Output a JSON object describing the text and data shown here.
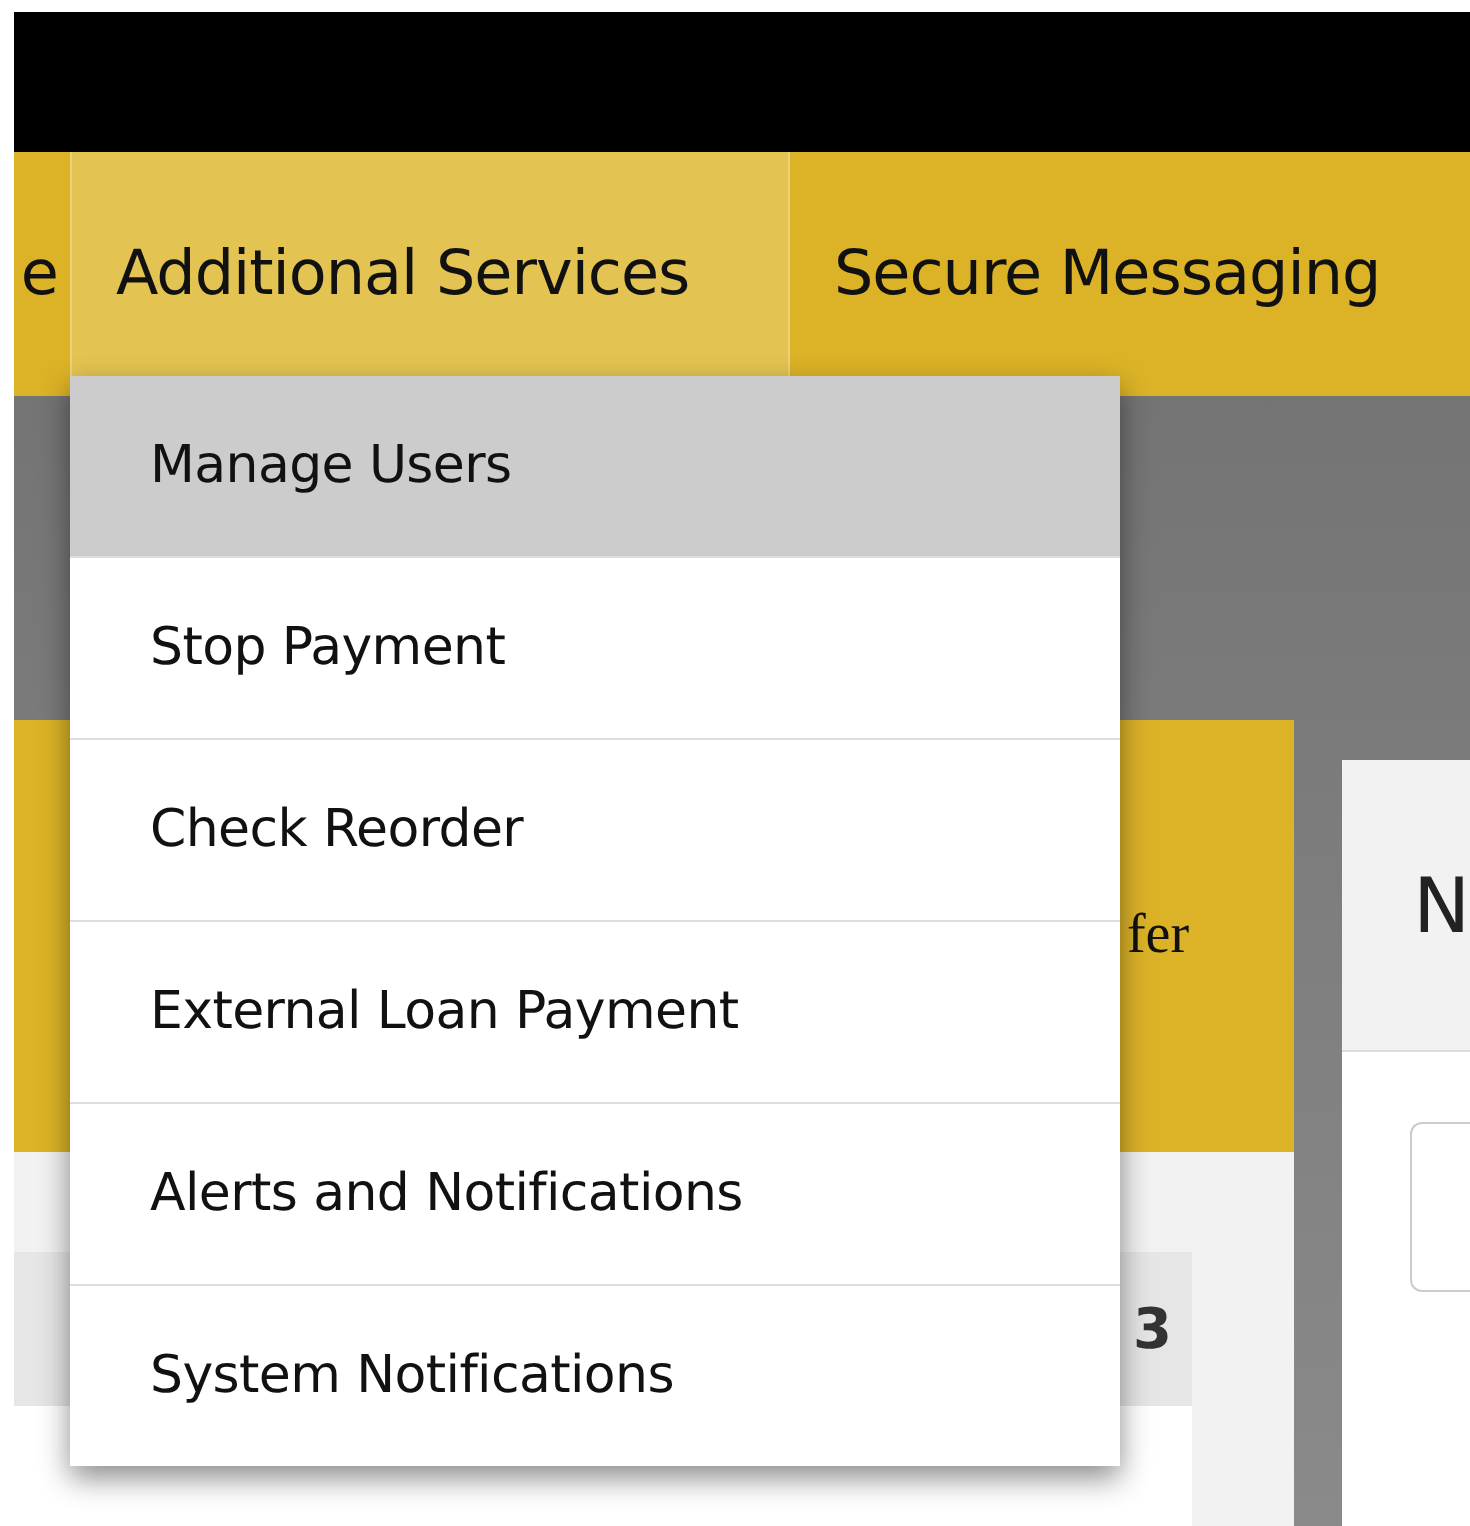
{
  "nav": {
    "items": [
      {
        "label": "e",
        "selected": false
      },
      {
        "label": "Additional Services",
        "selected": true
      },
      {
        "label": "Secure Messaging",
        "selected": false
      }
    ]
  },
  "dropdown": {
    "items": [
      {
        "label": "Manage Users",
        "selected": true
      },
      {
        "label": "Stop Payment",
        "selected": false
      },
      {
        "label": "Check Reorder",
        "selected": false
      },
      {
        "label": "External Loan Payment",
        "selected": false
      },
      {
        "label": "Alerts and Notifications",
        "selected": false
      },
      {
        "label": "System Notifications",
        "selected": false
      }
    ]
  },
  "left_panel": {
    "header_text": "fer",
    "table": {
      "columns": [
        "3"
      ]
    }
  },
  "right_panel": {
    "heading": "N"
  }
}
